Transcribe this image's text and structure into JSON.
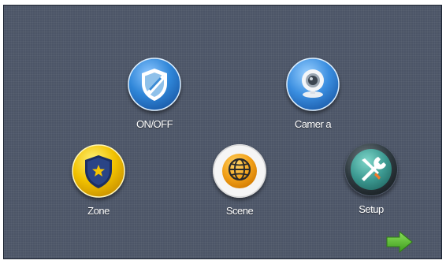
{
  "menu": {
    "items": [
      {
        "id": "onoff",
        "label": "ON/OFF",
        "icon": "shield-icon",
        "color": "#2f86d8"
      },
      {
        "id": "camera",
        "label": "Camer a",
        "icon": "webcam-icon",
        "color": "#3a8ee0"
      },
      {
        "id": "zone",
        "label": "Zone",
        "icon": "police-badge-icon",
        "color": "#f2c200"
      },
      {
        "id": "scene",
        "label": "Scene",
        "icon": "globe-icon",
        "color": "#f3a21a"
      },
      {
        "id": "setup",
        "label": "Setup",
        "icon": "tools-icon",
        "color": "#3d9a92"
      }
    ]
  },
  "navigation": {
    "next_icon": "right-arrow-icon",
    "next_color": "#5fc23a"
  },
  "theme": {
    "background": "#4c5567"
  }
}
